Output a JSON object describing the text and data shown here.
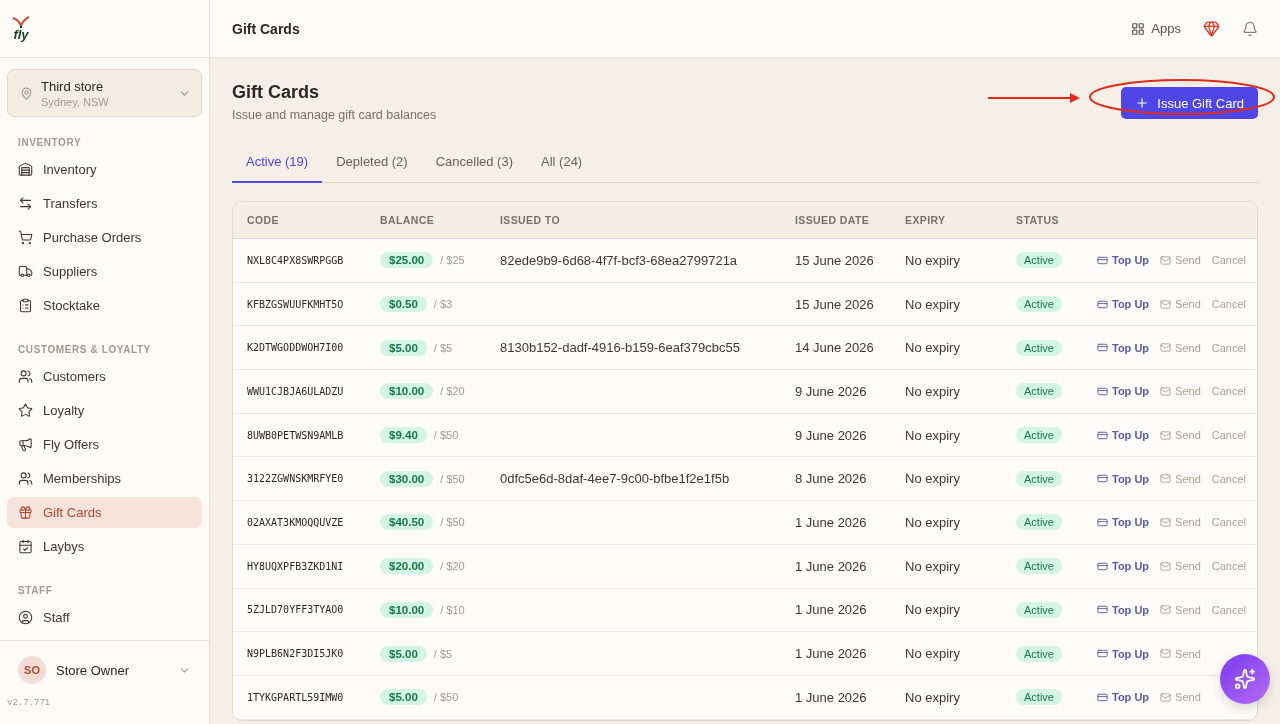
{
  "brand": {
    "logo": "fly"
  },
  "store": {
    "name": "Third store",
    "location": "Sydney, NSW"
  },
  "sidebar": {
    "sections": [
      {
        "title": "INVENTORY",
        "items": [
          {
            "label": "Inventory",
            "selected": false
          },
          {
            "label": "Transfers",
            "selected": false
          },
          {
            "label": "Purchase Orders",
            "selected": false
          },
          {
            "label": "Suppliers",
            "selected": false
          },
          {
            "label": "Stocktake",
            "selected": false
          }
        ]
      },
      {
        "title": "CUSTOMERS & LOYALTY",
        "items": [
          {
            "label": "Customers",
            "selected": false
          },
          {
            "label": "Loyalty",
            "selected": false
          },
          {
            "label": "Fly Offers",
            "selected": false
          },
          {
            "label": "Memberships",
            "selected": false
          },
          {
            "label": "Gift Cards",
            "selected": true
          },
          {
            "label": "Laybys",
            "selected": false
          }
        ]
      },
      {
        "title": "STAFF",
        "items": [
          {
            "label": "Staff",
            "selected": false
          }
        ]
      }
    ],
    "user": {
      "initials": "SO",
      "name": "Store Owner"
    },
    "version": "v2.7.771"
  },
  "topbar": {
    "title": "Gift Cards",
    "apps": "Apps"
  },
  "page": {
    "title": "Gift Cards",
    "subtitle": "Issue and manage gift card balances",
    "primary_button": "Issue Gift Card"
  },
  "tabs": [
    {
      "label": "Active (19)",
      "selected": true
    },
    {
      "label": "Depleted (2)",
      "selected": false
    },
    {
      "label": "Cancelled (3)",
      "selected": false
    },
    {
      "label": "All (24)",
      "selected": false
    }
  ],
  "table": {
    "columns": [
      "CODE",
      "BALANCE",
      "ISSUED TO",
      "ISSUED DATE",
      "EXPIRY",
      "STATUS"
    ],
    "rows": [
      {
        "code": "NXL8C4PX8SWRPGGB",
        "balance": "$25.00",
        "total": "/ $25",
        "issued_to": "82ede9b9-6d68-4f7f-bcf3-68ea2799721a",
        "issued_date": "15 June 2026",
        "expiry": "No expiry",
        "status": "Active",
        "actions": [
          "Top Up",
          "Send",
          "Cancel"
        ]
      },
      {
        "code": "KFBZGSWUUFKMHT5O",
        "balance": "$0.50",
        "total": "/ $3",
        "issued_date": "15 June 2026",
        "expiry": "No expiry",
        "status": "Active",
        "actions": [
          "Top Up",
          "Send",
          "Cancel"
        ]
      },
      {
        "code": "K2DTWGODDWOH7I00",
        "balance": "$5.00",
        "total": "/ $5",
        "issued_to": "8130b152-dadf-4916-b159-6eaf379cbc55",
        "issued_date": "14 June 2026",
        "expiry": "No expiry",
        "status": "Active",
        "actions": [
          "Top Up",
          "Send",
          "Cancel"
        ]
      },
      {
        "code": "WWU1CJBJA6ULADZU",
        "balance": "$10.00",
        "total": "/ $20",
        "issued_date": "9 June 2026",
        "expiry": "No expiry",
        "status": "Active",
        "actions": [
          "Top Up",
          "Send",
          "Cancel"
        ]
      },
      {
        "code": "8UWB0PETWSN9AMLB",
        "balance": "$9.40",
        "total": "/ $50",
        "issued_date": "9 June 2026",
        "expiry": "No expiry",
        "status": "Active",
        "actions": [
          "Top Up",
          "Send",
          "Cancel"
        ]
      },
      {
        "code": "3122ZGWNSKMRFYE0",
        "balance": "$30.00",
        "total": "/ $50",
        "issued_to": "0dfc5e6d-8daf-4ee7-9c00-bfbe1f2e1f5b",
        "issued_date": "8 June 2026",
        "expiry": "No expiry",
        "status": "Active",
        "actions": [
          "Top Up",
          "Send",
          "Cancel"
        ]
      },
      {
        "code": "02AXAT3KMOQQUVZE",
        "balance": "$40.50",
        "total": "/ $50",
        "issued_date": "1 June 2026",
        "expiry": "No expiry",
        "status": "Active",
        "actions": [
          "Top Up",
          "Send",
          "Cancel"
        ]
      },
      {
        "code": "HY8UQXPFB3ZKD1NI",
        "balance": "$20.00",
        "total": "/ $20",
        "issued_date": "1 June 2026",
        "expiry": "No expiry",
        "status": "Active",
        "actions": [
          "Top Up",
          "Send",
          "Cancel"
        ]
      },
      {
        "code": "5ZJLD70YFF3TYAO0",
        "balance": "$10.00",
        "total": "/ $10",
        "issued_date": "1 June 2026",
        "expiry": "No expiry",
        "status": "Active",
        "actions": [
          "Top Up",
          "Send",
          "Cancel"
        ]
      },
      {
        "code": "N9PLB6N2F3DI5JK0",
        "balance": "$5.00",
        "total": "/ $5",
        "issued_date": "1 June 2026",
        "expiry": "No expiry",
        "status": "Active",
        "actions": [
          "Top Up",
          "Send"
        ]
      },
      {
        "code": "1TYKGPARTL59IMW0",
        "balance": "$5.00",
        "total": "/ $50",
        "issued_date": "1 June 2026",
        "expiry": "No expiry",
        "status": "Active",
        "actions": [
          "Top Up",
          "Send"
        ]
      }
    ]
  }
}
